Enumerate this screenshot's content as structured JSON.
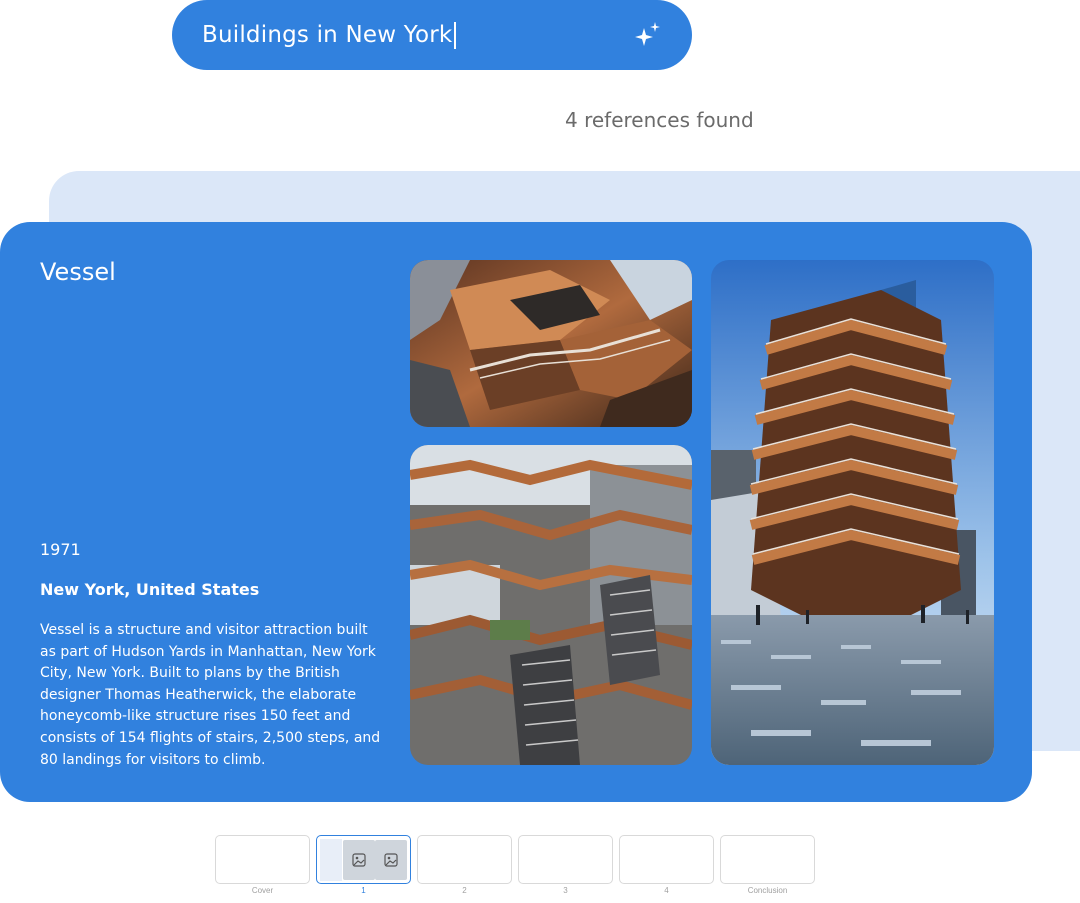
{
  "search": {
    "query": "Buildings in New York"
  },
  "results": {
    "count_text": "4 references found"
  },
  "card": {
    "title": "Vessel",
    "year": "1971",
    "location": "New York, United States",
    "description": "Vessel is a structure and visitor attraction built as part of Hudson Yards in Manhattan, New York City, New York. Built to plans by the British designer Thomas Heatherwick, the elaborate honeycomb-like structure rises 150 feet and consists of 154 flights of stairs, 2,500 steps, and 80 landings for visitors to climb."
  },
  "thumbnails": [
    {
      "label": "Cover"
    },
    {
      "label": "1",
      "active": true
    },
    {
      "label": "2"
    },
    {
      "label": "3"
    },
    {
      "label": "4"
    },
    {
      "label": "Conclusion"
    }
  ],
  "colors": {
    "accent": "#3181DE",
    "back_card": "#DBE7F8",
    "muted_text": "#6b6b6b"
  },
  "icons": {
    "search_action": "sparkle-icon",
    "thumbnail_image": "image-icon"
  }
}
